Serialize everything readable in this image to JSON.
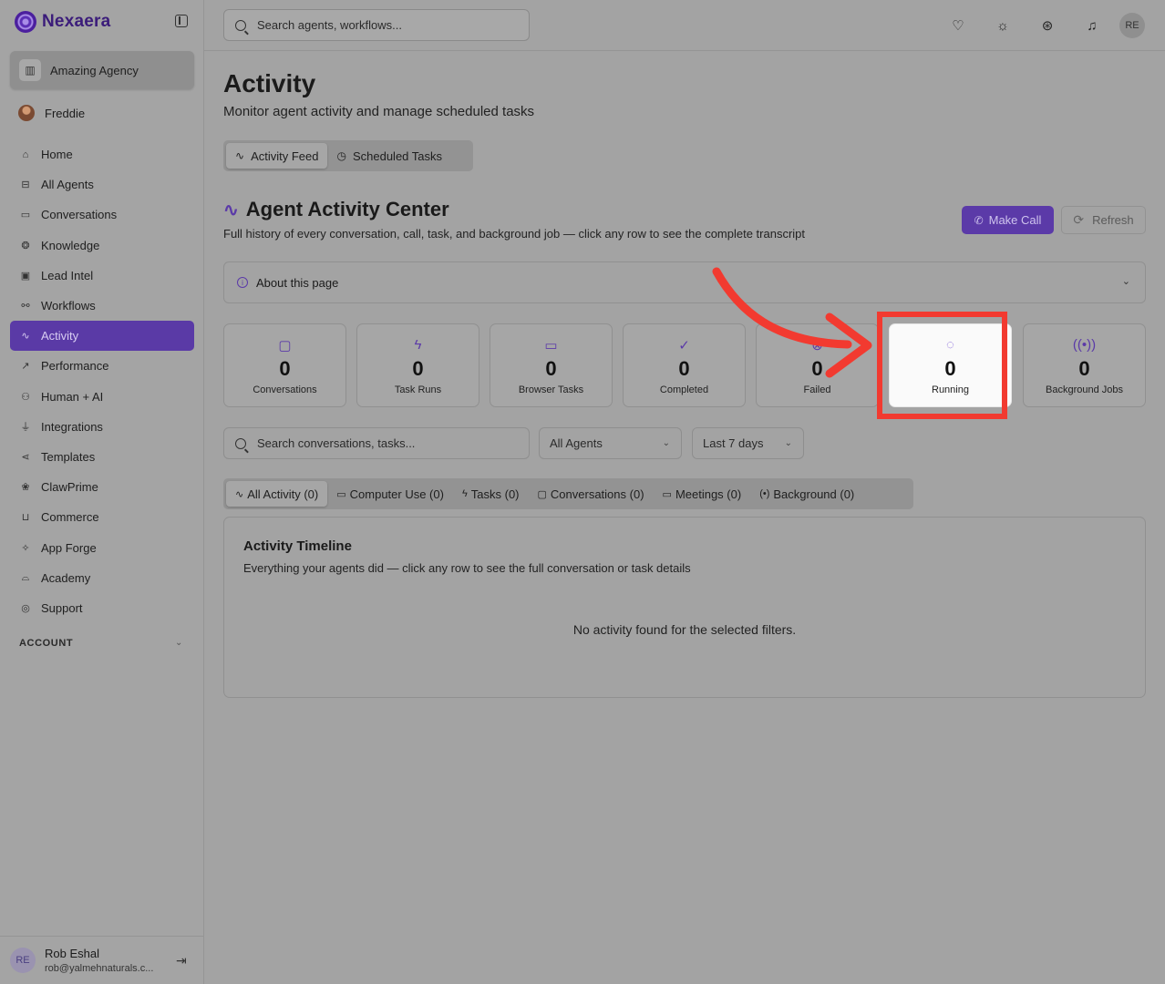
{
  "app": {
    "brand": "Nexaera",
    "accent_color": "#5b3aa8",
    "highlight_color": "#f23a30"
  },
  "sidebar": {
    "workspace": "Amazing Agency",
    "user_name": "Freddie",
    "items": [
      {
        "label": "Home",
        "icon": "home-icon"
      },
      {
        "label": "All Agents",
        "icon": "bot-icon"
      },
      {
        "label": "Conversations",
        "icon": "chat-icon"
      },
      {
        "label": "Knowledge",
        "icon": "brain-icon"
      },
      {
        "label": "Lead Intel",
        "icon": "contact-icon"
      },
      {
        "label": "Workflows",
        "icon": "workflow-icon"
      },
      {
        "label": "Activity",
        "icon": "activity-icon",
        "active": true
      },
      {
        "label": "Performance",
        "icon": "trend-icon"
      },
      {
        "label": "Human + AI",
        "icon": "users-icon"
      },
      {
        "label": "Integrations",
        "icon": "plug-icon"
      },
      {
        "label": "Templates",
        "icon": "share-icon"
      },
      {
        "label": "ClawPrime",
        "icon": "paw-icon"
      },
      {
        "label": "Commerce",
        "icon": "cart-icon"
      },
      {
        "label": "App Forge",
        "icon": "sparkles-icon"
      },
      {
        "label": "Academy",
        "icon": "graduation-cap-icon"
      },
      {
        "label": "Support",
        "icon": "support-icon"
      }
    ],
    "account_label": "ACCOUNT",
    "footer": {
      "initials": "RE",
      "name": "Rob Eshal",
      "email": "rob@yalmehnaturals.c..."
    }
  },
  "topbar": {
    "search_placeholder": "Search agents, workflows...",
    "avatar_initials": "RE"
  },
  "page": {
    "title": "Activity",
    "subtitle": "Monitor agent activity and manage scheduled tasks",
    "tabs": [
      {
        "label": "Activity Feed"
      },
      {
        "label": "Scheduled Tasks"
      }
    ]
  },
  "activity_center": {
    "title": "Agent Activity Center",
    "description": "Full history of every conversation, call, task, and background job — click any row to see the complete transcript",
    "make_call_label": "Make Call",
    "refresh_label": "Refresh",
    "about_label": "About this page"
  },
  "stats": [
    {
      "value": "0",
      "label": "Conversations",
      "icon": "message-square-icon"
    },
    {
      "value": "0",
      "label": "Task Runs",
      "icon": "zap-icon"
    },
    {
      "value": "0",
      "label": "Browser Tasks",
      "icon": "monitor-play-icon"
    },
    {
      "value": "0",
      "label": "Completed",
      "icon": "check-circle-icon"
    },
    {
      "value": "0",
      "label": "Failed",
      "icon": "x-circle-icon"
    },
    {
      "value": "0",
      "label": "Running",
      "icon": "loader-icon"
    },
    {
      "value": "0",
      "label": "Background Jobs",
      "icon": "radio-icon"
    }
  ],
  "filters": {
    "search_placeholder": "Search conversations, tasks...",
    "agent_select": "All Agents",
    "range_select": "Last 7 days"
  },
  "sub_tabs": [
    {
      "label": "All Activity (0)"
    },
    {
      "label": "Computer Use (0)"
    },
    {
      "label": "Tasks (0)"
    },
    {
      "label": "Conversations (0)"
    },
    {
      "label": "Meetings (0)"
    },
    {
      "label": "Background (0)"
    }
  ],
  "timeline": {
    "title": "Activity Timeline",
    "description": "Everything your agents did — click any row to see the full conversation or task details",
    "empty_text": "No activity found for the selected filters."
  }
}
